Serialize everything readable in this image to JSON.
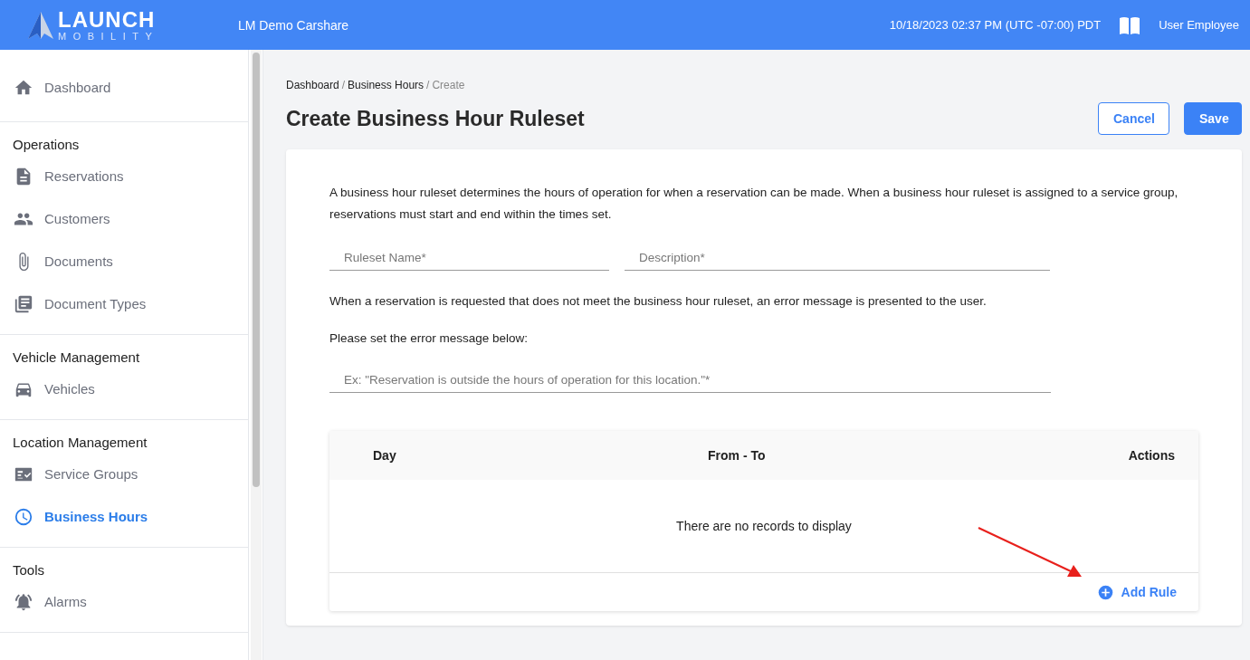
{
  "header": {
    "logo_title": "LAUNCH",
    "logo_subtitle": "MOBILITY",
    "org": "LM Demo Carshare",
    "datetime": "10/18/2023 02:37 PM (UTC -07:00) PDT",
    "user": "User Employee"
  },
  "sidebar": {
    "sections": [
      {
        "items": [
          {
            "label": "Dashboard",
            "kind": "home",
            "selected": false
          }
        ]
      },
      {
        "heading": "Operations",
        "items": [
          {
            "label": "Reservations",
            "kind": "file",
            "selected": false
          },
          {
            "label": "Customers",
            "kind": "people",
            "selected": false
          },
          {
            "label": "Documents",
            "kind": "clip",
            "selected": false
          },
          {
            "label": "Document Types",
            "kind": "library",
            "selected": false
          }
        ]
      },
      {
        "heading": "Vehicle Management",
        "items": [
          {
            "label": "Vehicles",
            "kind": "car",
            "selected": false
          }
        ]
      },
      {
        "heading": "Location Management",
        "items": [
          {
            "label": "Service Groups",
            "kind": "checklist",
            "selected": false
          },
          {
            "label": "Business Hours",
            "kind": "clock",
            "selected": true
          }
        ]
      },
      {
        "heading": "Tools",
        "items": [
          {
            "label": "Alarms",
            "kind": "alarm",
            "selected": false
          }
        ]
      }
    ]
  },
  "breadcrumb": [
    {
      "label": "Dashboard",
      "current": false
    },
    {
      "label": "Business Hours",
      "current": false
    },
    {
      "label": "Create",
      "current": true
    }
  ],
  "breadcrumb_separators": [
    "/",
    "/"
  ],
  "page_title": "Create Business Hour Ruleset",
  "buttons": {
    "cancel": "Cancel",
    "save": "Save"
  },
  "intro": "A business hour ruleset determines the hours of operation for when a reservation can be made. When a business hour ruleset is assigned to a service group, reservations must start and end within the times set.",
  "fields": [
    {
      "placeholder": "Ruleset Name*"
    },
    {
      "placeholder": "Description*"
    }
  ],
  "error_note": "When a reservation is requested that does not meet the business hour ruleset, an error message is presented to the user.",
  "error_prompt": "Please set the error message below:",
  "error_field": {
    "placeholder": "Ex: \"Reservation is outside the hours of operation for this location.\"*"
  },
  "table": {
    "columns": [
      "Day",
      "From - To",
      "Actions"
    ],
    "empty": "There are no records to display",
    "add_rule": "Add Rule"
  }
}
